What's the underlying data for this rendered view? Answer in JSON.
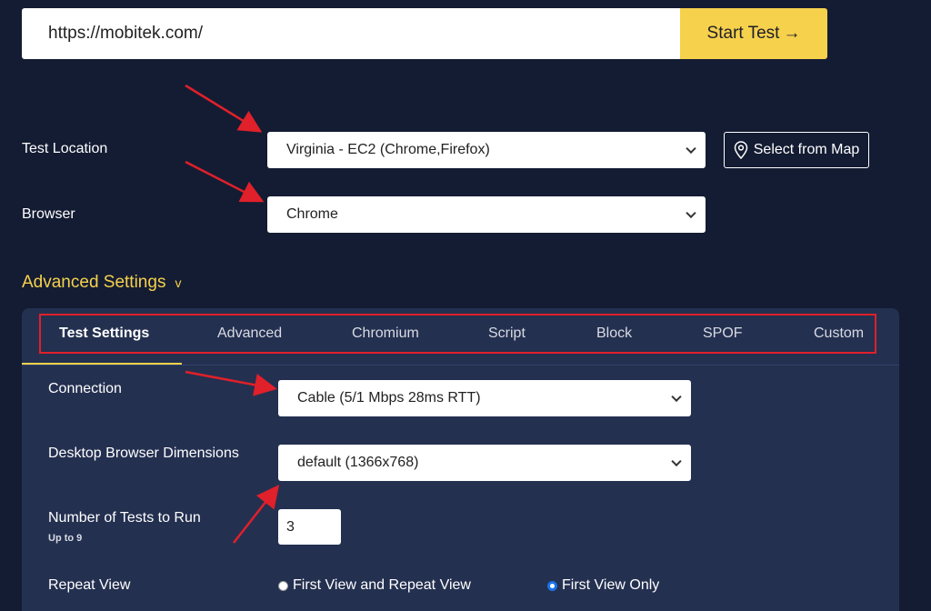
{
  "url_bar": {
    "value": "https://mobitek.com/",
    "start_label": "Start Test",
    "start_arrow": "→"
  },
  "test_location": {
    "label": "Test Location",
    "value": "Virginia - EC2 (Chrome,Firefox)",
    "map_button": "Select from Map"
  },
  "browser": {
    "label": "Browser",
    "value": "Chrome"
  },
  "advanced": {
    "title": "Advanced Settings",
    "caret": "v",
    "tabs": [
      {
        "label": "Test Settings"
      },
      {
        "label": "Advanced"
      },
      {
        "label": "Chromium"
      },
      {
        "label": "Script"
      },
      {
        "label": "Block"
      },
      {
        "label": "SPOF"
      },
      {
        "label": "Custom"
      }
    ]
  },
  "settings": {
    "connection": {
      "label": "Connection",
      "value": "Cable (5/1 Mbps 28ms RTT)"
    },
    "dimensions": {
      "label": "Desktop Browser Dimensions",
      "value": "default (1366x768)"
    },
    "num_tests": {
      "label": "Number of Tests to Run",
      "sublabel": "Up to 9",
      "value": "3"
    },
    "repeat_view": {
      "label": "Repeat View",
      "options": [
        {
          "label": "First View and Repeat View",
          "checked": false
        },
        {
          "label": "First View Only",
          "checked": true
        }
      ]
    }
  },
  "colors": {
    "background": "#141c33",
    "panel": "#243050",
    "accent": "#f6d14c",
    "annotation_red": "#e0202a"
  }
}
